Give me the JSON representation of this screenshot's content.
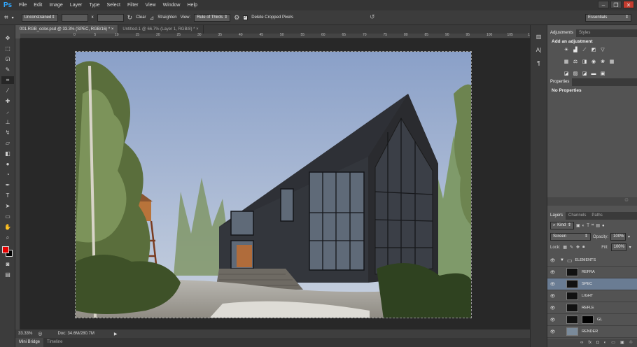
{
  "app": {
    "logo": "Ps"
  },
  "menu": [
    "File",
    "Edit",
    "Image",
    "Layer",
    "Type",
    "Select",
    "Filter",
    "View",
    "Window",
    "Help"
  ],
  "window_controls": {
    "minimize": "–",
    "restore": "❐",
    "close": "✕"
  },
  "options": {
    "ratio": "Unconstrained",
    "swap": "x",
    "clear": "Clear",
    "straighten": "Straighten",
    "view_label": "View:",
    "view_value": "Rule of Thirds",
    "delete_cropped": "Delete Cropped Pixels",
    "workspace": "Essentials"
  },
  "tabs": [
    {
      "label": "001.RGB_color.psd @ 33.3% (SPEC, RGB/16) *",
      "close": "×"
    },
    {
      "label": "Untitled-1 @ 66.7% (Layer 1, RGB/8) *",
      "close": "×"
    }
  ],
  "ruler_ticks": [
    "0",
    "5",
    "10",
    "15",
    "20",
    "25",
    "30",
    "35",
    "40",
    "45",
    "50",
    "55",
    "60",
    "65",
    "70",
    "75",
    "80",
    "85",
    "90",
    "95",
    "100",
    "105",
    "110",
    "115"
  ],
  "status": {
    "zoom": "33.33%",
    "doc": "Doc: 34.6M/280.7M"
  },
  "bottom_tabs": [
    "Mini Bridge",
    "Timeline"
  ],
  "adjustments": {
    "tabs": [
      "Adjustments",
      "Styles"
    ],
    "title": "Add an adjustment"
  },
  "properties": {
    "tab": "Properties",
    "text": "No Properties"
  },
  "layers": {
    "tabs": [
      "Layers",
      "Channels",
      "Paths"
    ],
    "kind": "Kind",
    "blend_mode": "Screen",
    "opacity_label": "Opacity:",
    "opacity": "100%",
    "lock_label": "Lock:",
    "fill_label": "Fill:",
    "fill": "100%",
    "items": [
      {
        "name": "ELEMENTS",
        "type": "group"
      },
      {
        "name": "REFRA",
        "type": "layer"
      },
      {
        "name": "SPEC",
        "type": "layer",
        "selected": true
      },
      {
        "name": "LIGHT",
        "type": "layer"
      },
      {
        "name": "REFLE",
        "type": "layer"
      },
      {
        "name": "GL",
        "type": "layer"
      },
      {
        "name": "RENDER",
        "type": "layer"
      }
    ],
    "footer_fx": "fx"
  },
  "colors": {
    "foreground": "#e60000",
    "background": "#000000",
    "accent": "#31a8ff",
    "selected_layer": "#6a7c93"
  }
}
